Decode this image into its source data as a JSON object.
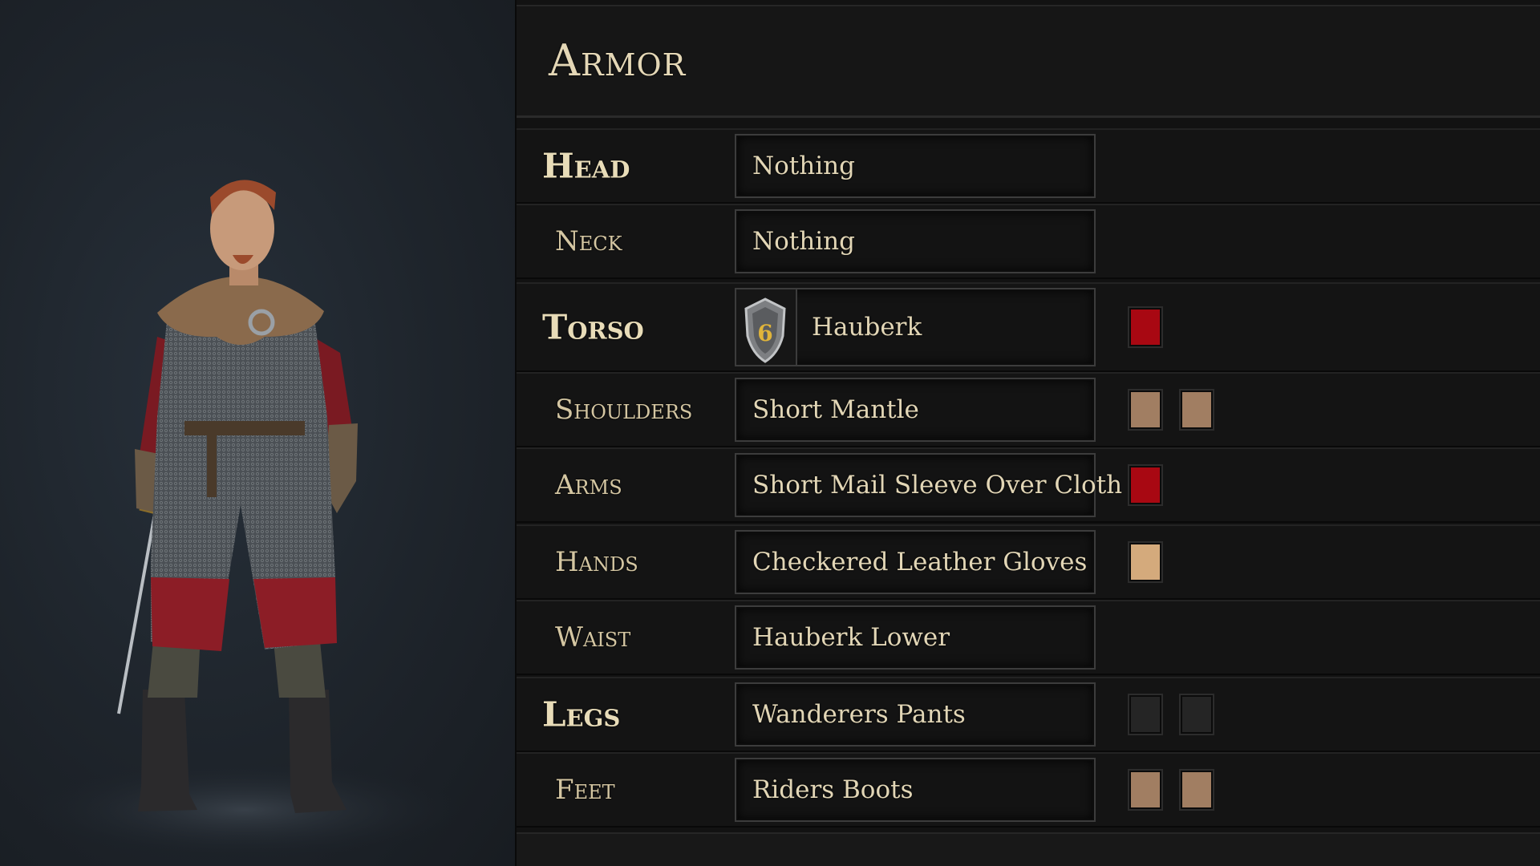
{
  "title": "Armor",
  "slots": [
    {
      "label": "Head",
      "item": "Nothing",
      "major": true,
      "badge": null,
      "colors": []
    },
    {
      "label": "Neck",
      "item": "Nothing",
      "major": false,
      "badge": null,
      "colors": []
    },
    {
      "label": "Torso",
      "item": "Hauberk",
      "major": true,
      "badge": "6",
      "colors": [
        "#a80812"
      ]
    },
    {
      "label": "Shoulders",
      "item": "Short Mantle",
      "major": false,
      "badge": null,
      "colors": [
        "#a17e62",
        "#a17e62"
      ]
    },
    {
      "label": "Arms",
      "item": "Short Mail Sleeve Over Cloth",
      "major": false,
      "badge": null,
      "colors": [
        "#a80812"
      ]
    },
    {
      "label": "Hands",
      "item": "Checkered Leather Gloves",
      "major": false,
      "badge": null,
      "colors": [
        "#d4aa7c"
      ]
    },
    {
      "label": "Waist",
      "item": "Hauberk Lower",
      "major": false,
      "badge": null,
      "colors": []
    },
    {
      "label": "Legs",
      "item": "Wanderers Pants",
      "major": true,
      "badge": null,
      "colors": [
        "#252525",
        "#252525"
      ]
    },
    {
      "label": "Feet",
      "item": "Riders Boots",
      "major": false,
      "badge": null,
      "colors": [
        "#a17e62",
        "#a17e62"
      ]
    }
  ]
}
